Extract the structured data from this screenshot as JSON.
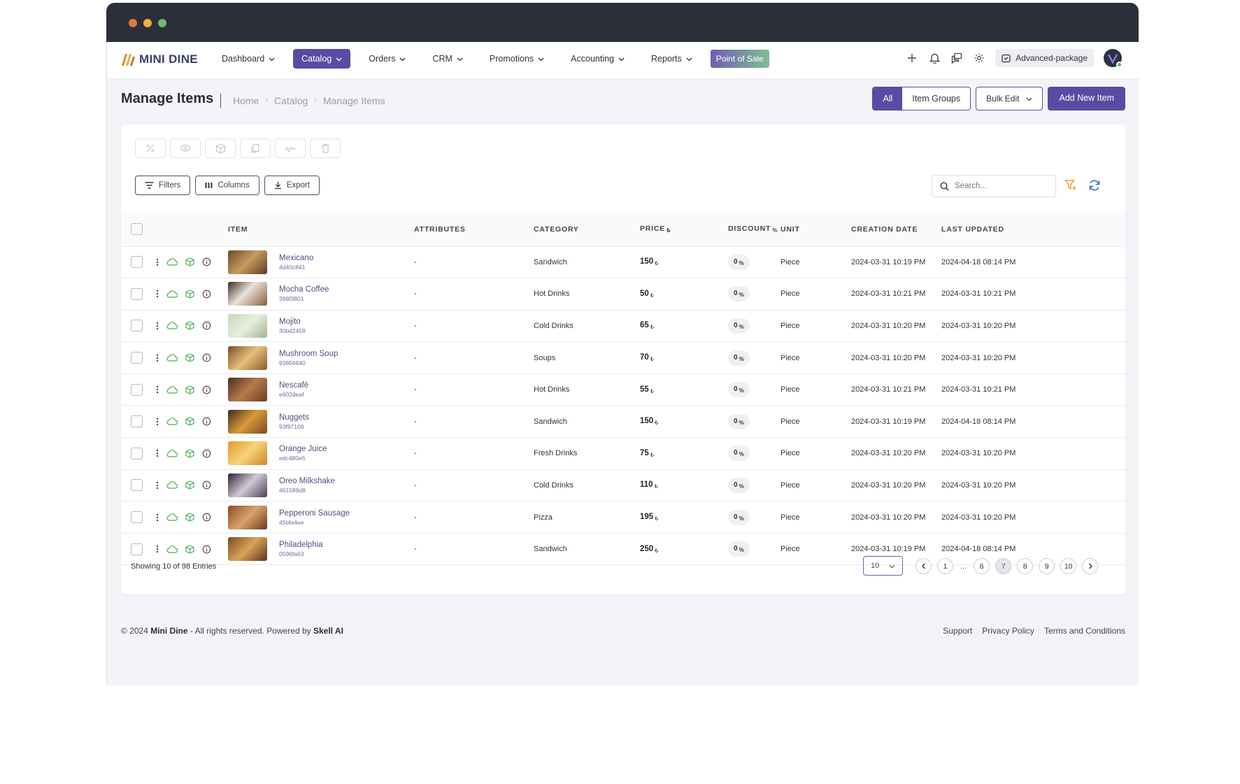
{
  "brand": {
    "name": "MINI DINE"
  },
  "nav": {
    "items": [
      {
        "label": "Dashboard",
        "active": false
      },
      {
        "label": "Catalog",
        "active": true
      },
      {
        "label": "Orders",
        "active": false
      },
      {
        "label": "CRM",
        "active": false
      },
      {
        "label": "Promotions",
        "active": false
      },
      {
        "label": "Accounting",
        "active": false
      },
      {
        "label": "Reports",
        "active": false
      }
    ],
    "pos_label": "Point of Sale",
    "package_label": "Advanced-package"
  },
  "page": {
    "title": "Manage Items",
    "breadcrumb": [
      "Home",
      "Catalog",
      "Manage Items"
    ],
    "toggle": {
      "all": "All",
      "groups": "Item Groups"
    },
    "bulk_edit": "Bulk Edit",
    "add_new": "Add New Item"
  },
  "toolbar": {
    "filters": "Filters",
    "columns": "Columns",
    "export": "Export",
    "search_placeholder": "Search..."
  },
  "table": {
    "columns": [
      "ITEM",
      "ATTRIBUTES",
      "CATEGORY",
      "PRICE",
      "DISCOUNT",
      "UNIT",
      "CREATION DATE",
      "LAST UPDATED"
    ],
    "rows": [
      {
        "name": "Mexicano",
        "code": "4d40c841",
        "attributes": "-",
        "category": "Sandwich",
        "price": "150",
        "discount": "0",
        "unit": "Piece",
        "created": "2024-03-31 10:19 PM",
        "updated": "2024-04-18 08:14 PM"
      },
      {
        "name": "Mocha Coffee",
        "code": "398f3801",
        "attributes": "-",
        "category": "Hot Drinks",
        "price": "50",
        "discount": "0",
        "unit": "Piece",
        "created": "2024-03-31 10:21 PM",
        "updated": "2024-03-31 10:21 PM"
      },
      {
        "name": "Mojito",
        "code": "30bd2459",
        "attributes": "-",
        "category": "Cold Drinks",
        "price": "65",
        "discount": "0",
        "unit": "Piece",
        "created": "2024-03-31 10:20 PM",
        "updated": "2024-03-31 10:20 PM"
      },
      {
        "name": "Mushroom Soup",
        "code": "93856640",
        "attributes": "-",
        "category": "Soups",
        "price": "70",
        "discount": "0",
        "unit": "Piece",
        "created": "2024-03-31 10:20 PM",
        "updated": "2024-03-31 10:20 PM"
      },
      {
        "name": "Nescafé",
        "code": "e602deaf",
        "attributes": "-",
        "category": "Hot Drinks",
        "price": "55",
        "discount": "0",
        "unit": "Piece",
        "created": "2024-03-31 10:21 PM",
        "updated": "2024-03-31 10:21 PM"
      },
      {
        "name": "Nuggets",
        "code": "93f97109",
        "attributes": "-",
        "category": "Sandwich",
        "price": "150",
        "discount": "0",
        "unit": "Piece",
        "created": "2024-03-31 10:19 PM",
        "updated": "2024-04-18 08:14 PM"
      },
      {
        "name": "Orange Juice",
        "code": "edc480e5",
        "attributes": "-",
        "category": "Fresh Drinks",
        "price": "75",
        "discount": "0",
        "unit": "Piece",
        "created": "2024-03-31 10:20 PM",
        "updated": "2024-03-31 10:20 PM"
      },
      {
        "name": "Oreo Milkshake",
        "code": "461589d8",
        "attributes": "-",
        "category": "Cold Drinks",
        "price": "110",
        "discount": "0",
        "unit": "Piece",
        "created": "2024-03-31 10:20 PM",
        "updated": "2024-03-31 10:20 PM"
      },
      {
        "name": "Pepperoni Sausage",
        "code": "45bfa4ee",
        "attributes": "-",
        "category": "Pizza",
        "price": "195",
        "discount": "0",
        "unit": "Piece",
        "created": "2024-03-31 10:20 PM",
        "updated": "2024-03-31 10:20 PM"
      },
      {
        "name": "Philadelphia",
        "code": "0596fa63",
        "attributes": "-",
        "category": "Sandwich",
        "price": "250",
        "discount": "0",
        "unit": "Piece",
        "created": "2024-03-31 10:19 PM",
        "updated": "2024-04-18 08:14 PM"
      }
    ]
  },
  "pagination": {
    "showing": "Showing 10 of 98 Entries",
    "page_size": "10",
    "pages": [
      "1",
      "...",
      "6",
      "7",
      "8",
      "9",
      "10"
    ],
    "current": "7"
  },
  "footer": {
    "copyright_prefix": "© 2024",
    "brand": "Mini Dine",
    "middle": "- All rights reserved. Powered by",
    "powered_by": "Skell AI",
    "links": [
      "Support",
      "Privacy Policy",
      "Terms and Conditions"
    ]
  },
  "colors": {
    "primary": "#5b4aa3",
    "titlebar": "#2b2f3a",
    "accent_green": "#4caf50",
    "filter_clear": "#e8a33a"
  }
}
